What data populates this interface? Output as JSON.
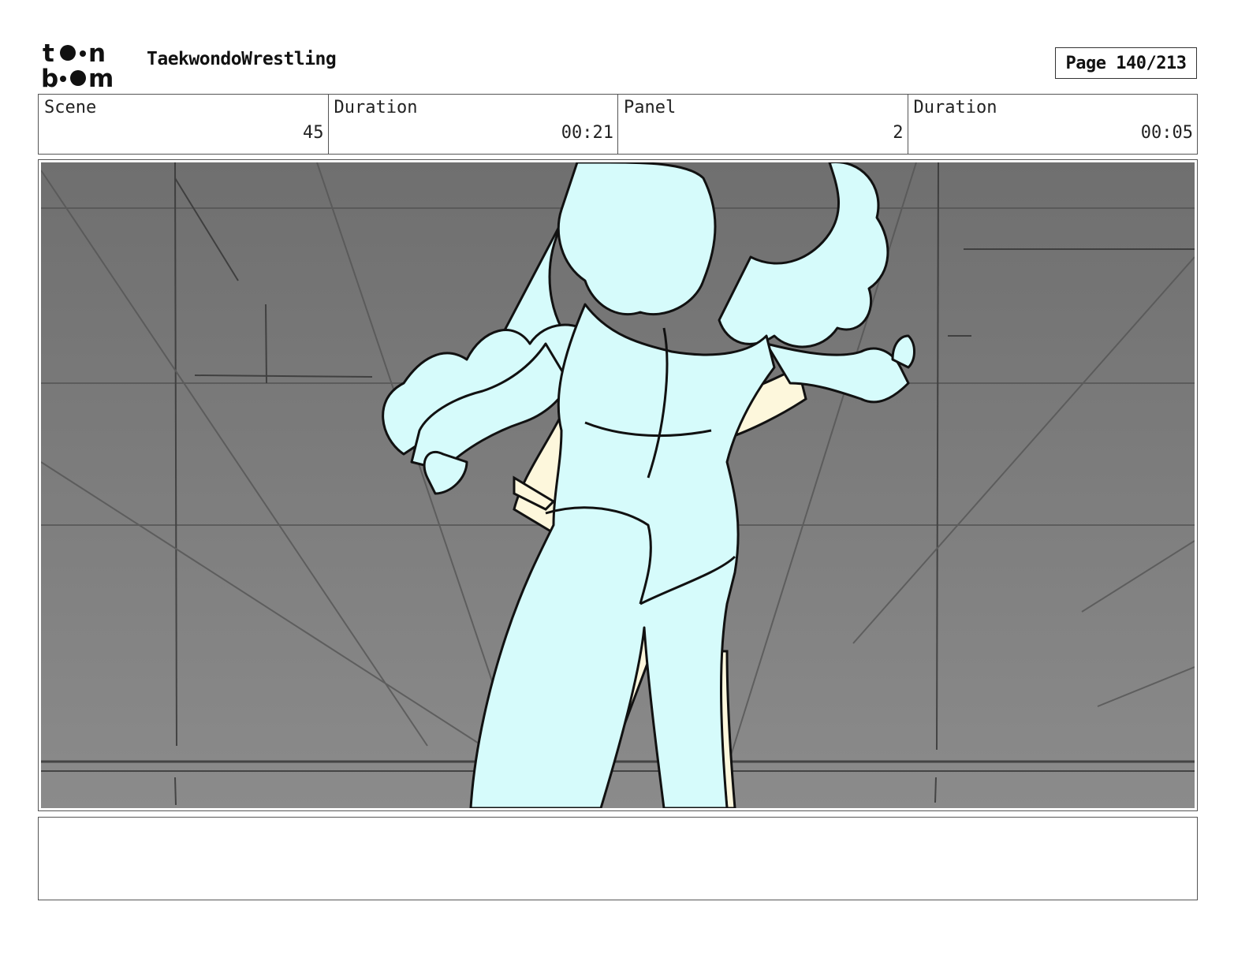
{
  "header": {
    "logo_top": "t••n",
    "logo_bottom": "b••m",
    "project_title": "TaekwondoWrestling",
    "page_label": "Page 140/213"
  },
  "info": {
    "scene_label": "Scene",
    "scene_value": "45",
    "scene_duration_label": "Duration",
    "scene_duration_value": "00:21",
    "panel_label": "Panel",
    "panel_value": "2",
    "panel_duration_label": "Duration",
    "panel_duration_value": "00:05"
  },
  "notes": {
    "text": ""
  },
  "colors": {
    "background_gray": "#7d7d7d",
    "character_blue": "#d6fbfb",
    "character_cream": "#fdf7dc",
    "line": "#111111"
  }
}
